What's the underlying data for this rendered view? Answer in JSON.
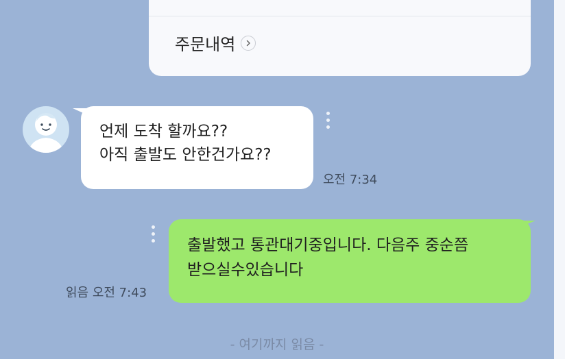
{
  "order_card": {
    "link_label": "주문내역"
  },
  "incoming": {
    "lines": [
      "언제 도착 할까요??",
      "아직 출발도 안한건가요??"
    ],
    "time": "오전 7:34"
  },
  "outgoing": {
    "lines": [
      "출발했고 통관대기중입니다. 다음주 중순쯤",
      "받으실수있습니다"
    ],
    "read_time": "읽음 오전 7:43"
  },
  "read_marker": "- 여기까지 읽음 -",
  "colors": {
    "background": "#9bb3d6",
    "outgoing_bubble": "#9de86c",
    "incoming_bubble": "#ffffff"
  },
  "icons": {
    "order_chevron": "chevron-right-icon",
    "avatar": "default-profile-icon",
    "more": "vertical-dots-icon"
  }
}
